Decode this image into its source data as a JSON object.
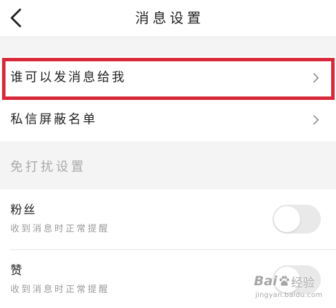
{
  "header": {
    "back_icon": "chevron-left-icon",
    "title": "消息设置"
  },
  "colors": {
    "background": "#f4f4f4",
    "surface": "#ffffff",
    "text": "#222222",
    "muted": "#9a9a9a",
    "highlight": "#d8293b",
    "toggle_off": "#e9e9e9",
    "divider": "#e7e7e7"
  },
  "nav_rows": [
    {
      "label": "谁可以发消息给我",
      "icon": "chevron-right-icon",
      "highlighted": true
    },
    {
      "label": "私信屏蔽名单",
      "icon": "chevron-right-icon",
      "highlighted": false
    }
  ],
  "dnd_section": {
    "title": "免打扰设置",
    "items": [
      {
        "title": "粉丝",
        "subtitle": "收到消息时正常提醒",
        "enabled": false
      },
      {
        "title": "赞",
        "subtitle": "收到消息时正常提醒",
        "enabled": false
      }
    ]
  },
  "watermark": {
    "logo_text": "Bai",
    "logo_icon": "paw-icon",
    "logo_text_cn": "经验",
    "url": "jingyan.baidu.com"
  }
}
